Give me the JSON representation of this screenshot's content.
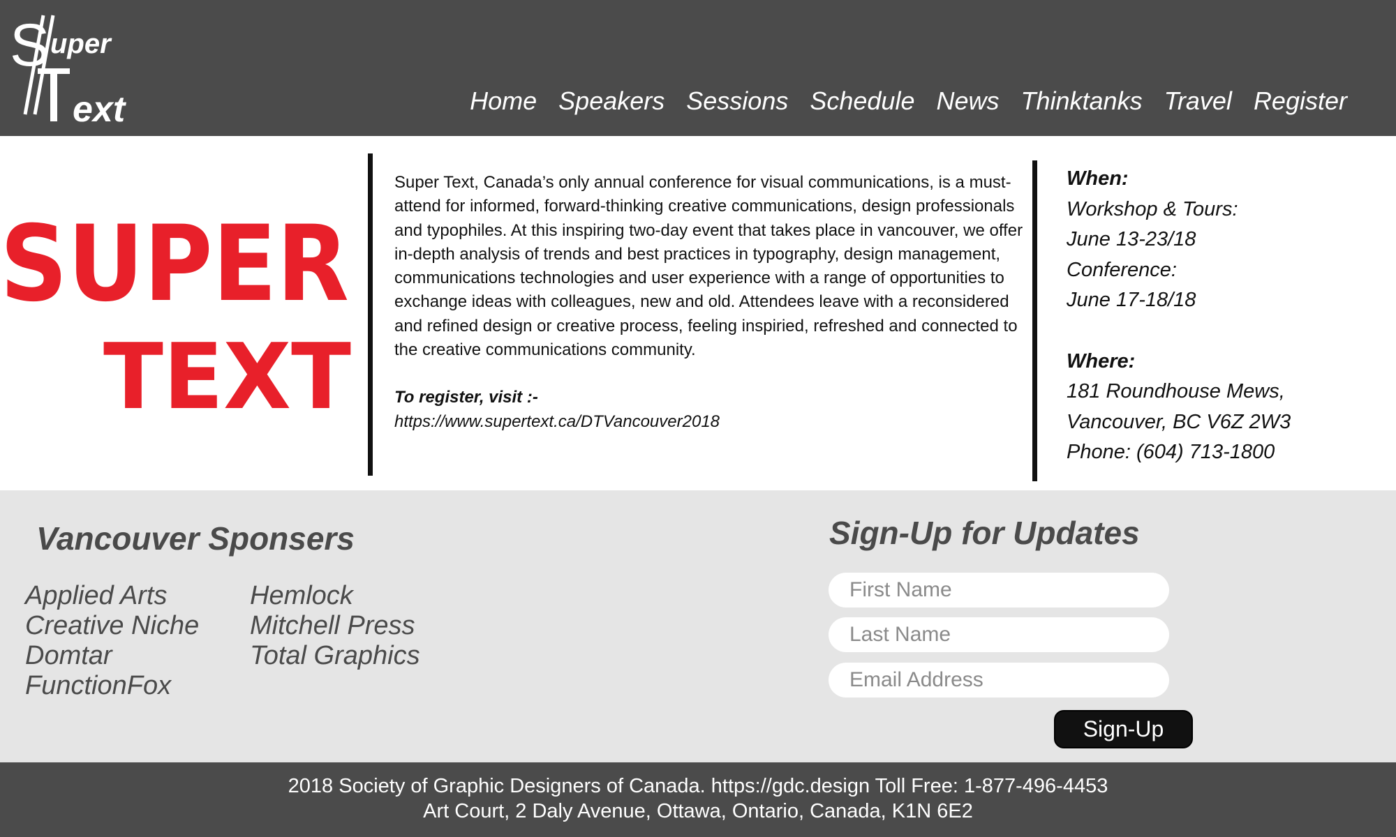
{
  "header": {
    "logo_text_top": "uper",
    "logo_text_bottom": "ext",
    "nav": [
      "Home",
      "Speakers",
      "Sessions",
      "Schedule",
      "News",
      "Thinktanks",
      "Travel",
      "Register"
    ]
  },
  "hero": {
    "logo_line1": "SUPER",
    "logo_line2": "TEXT",
    "about": "Super Text, Canada’s only annual conference for visual communications, is a must- attend for informed, forward-thinking creative communications, design professionals and typophiles. At this inspiring two-day event that takes place in vancouver, we offer in-depth analysis of trends and best practices in typography, design management, communications technologies and user experience with a range of opportunities to exchange ideas with colleagues, new and old. Attendees leave with a reconsidered and refined design or creative process, feeling inspiried, refreshed and connected to the creative communications community.",
    "register_label": "To register, visit :-",
    "register_url": "https://www.supertext.ca/DTVancouver2018"
  },
  "info": {
    "when_label": "When:",
    "workshop_label": "Workshop & Tours:",
    "workshop_dates": "June 13-23/18",
    "conference_label": "Conference:",
    "conference_dates": "June 17-18/18",
    "where_label": "Where:",
    "address1": "181 Roundhouse Mews,",
    "address2": "Vancouver, BC V6Z 2W3",
    "phone": "Phone: (604) 713-1800"
  },
  "sponsors": {
    "title": "Vancouver Sponsers",
    "col1": [
      "Applied Arts",
      "Creative Niche",
      "Domtar",
      "FunctionFox"
    ],
    "col2": [
      "Hemlock",
      "Mitchell Press",
      "Total Graphics"
    ]
  },
  "signup": {
    "title": "Sign-Up for Updates",
    "first_name_placeholder": "First Name",
    "last_name_placeholder": "Last Name",
    "email_placeholder": "Email Address",
    "button_label": "Sign-Up"
  },
  "footer": {
    "line1": "2018 Society of Graphic Designers of Canada.  https://gdc.design  Toll Free: 1-877-496-4453",
    "line2": "Art Court, 2 Daly Avenue, Ottawa, Ontario, Canada, K1N 6E2"
  },
  "colors": {
    "header_bg": "#4b4b4b",
    "accent_red": "#e8202a",
    "band_bg": "#e5e5e5",
    "text_gray": "#4a4a4a"
  }
}
